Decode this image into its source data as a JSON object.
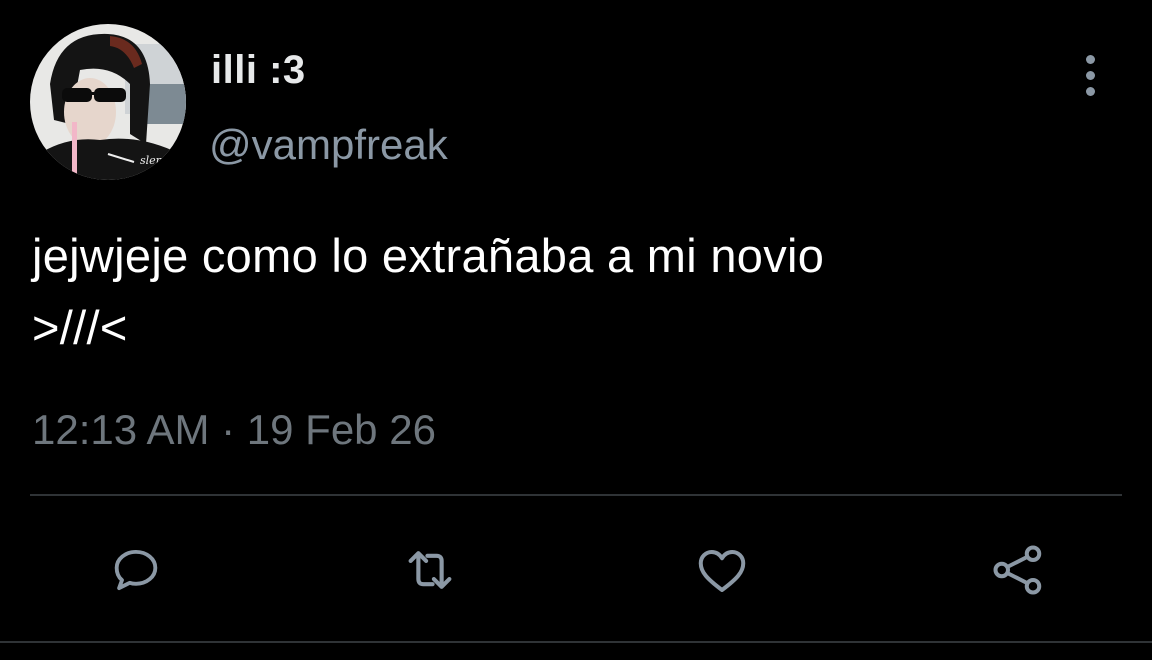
{
  "user": {
    "display_name": "illi :3",
    "handle": "@vampfreak",
    "avatar_icon": "user-avatar-photo"
  },
  "tweet": {
    "text": "jejwjeje como lo extrañaba a mi novio\n>///<",
    "timestamp": "12:13 AM · 19 Feb 26"
  },
  "actions": {
    "reply_icon": "reply-icon",
    "retweet_icon": "retweet-icon",
    "like_icon": "heart-icon",
    "share_icon": "share-icon"
  },
  "colors": {
    "background": "#000000",
    "text_primary": "#e7e9ea",
    "text_secondary": "#8b98a5",
    "divider": "#2f3336",
    "icon": "#8b98a5"
  }
}
